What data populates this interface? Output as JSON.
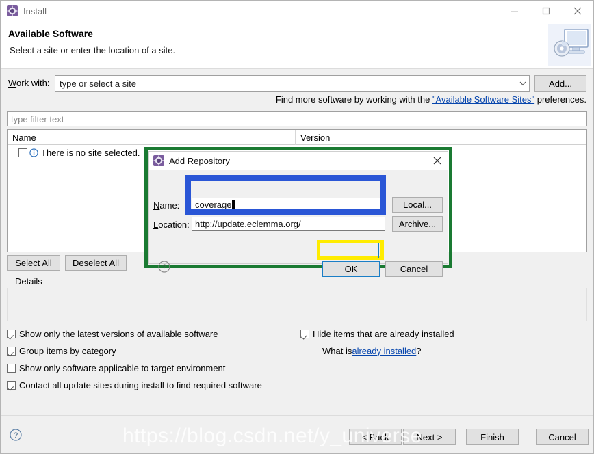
{
  "window": {
    "title": "Install",
    "icon": "eclipse-install-icon",
    "controls": {
      "minimize": "minimize-icon",
      "maximize": "maximize-icon",
      "close": "close-icon"
    }
  },
  "header": {
    "title": "Available Software",
    "subtitle": "Select a site or enter the location of a site.",
    "icon": "computer-with-disc-icon"
  },
  "work_with": {
    "label": "Work with:",
    "value": "type or select a site",
    "placeholder": "type or select a site",
    "dropdown_icon": "chevron-down-icon",
    "add_button": "Add..."
  },
  "find_more": {
    "prefix": "Find more software by working with the ",
    "link": "\"Available Software Sites\"",
    "suffix": " preferences."
  },
  "filter": {
    "placeholder": "type filter text",
    "value": "type filter text"
  },
  "table": {
    "columns": [
      "Name",
      "Version",
      ""
    ],
    "rows": [
      {
        "checked": false,
        "icon": "info-icon",
        "name": "There is no site selected.",
        "version": ""
      }
    ]
  },
  "buttons": {
    "select_all": "Select All",
    "deselect_all": "Deselect All"
  },
  "details": {
    "legend": "Details",
    "content": "",
    "spinner_icon": "up-down-spinner-icon"
  },
  "options": [
    {
      "label": "Show only the latest versions of available software",
      "checked": true,
      "mnemonic": "l"
    },
    {
      "label": "Group items by category",
      "checked": true,
      "mnemonic": "G"
    },
    {
      "label": "Show only software applicable to target environment",
      "checked": false,
      "mnemonic": ""
    },
    {
      "label": "Contact all update sites during install to find required software",
      "checked": true,
      "mnemonic": "C"
    }
  ],
  "options_right": {
    "checkbox": {
      "label": "Hide items that are already installed",
      "checked": true,
      "mnemonic": "H"
    },
    "hint_prefix": "What is ",
    "hint_link": "already installed",
    "hint_suffix": "?"
  },
  "footer": {
    "help_icon": "help-question-icon",
    "back": "< Back",
    "next": "Next >",
    "finish": "Finish",
    "cancel": "Cancel"
  },
  "watermark": {
    "text": "https://blog.csdn.net/y_universe"
  },
  "dialog": {
    "title": "Add Repository",
    "icon": "eclipse-install-icon",
    "close_icon": "close-icon",
    "name_label": "Name:",
    "name_value": "coverage",
    "location_label": "Location:",
    "location_value": "http://update.eclemma.org/",
    "local_button": "Local...",
    "archive_button": "Archive...",
    "ok_button": "OK",
    "cancel_button": "Cancel",
    "help_icon": "help-question-icon"
  },
  "annotations": {
    "green_outline_color": "#1a7a32",
    "blue_outline_color": "#2a56d6",
    "yellow_outline_color": "#ffec00"
  }
}
